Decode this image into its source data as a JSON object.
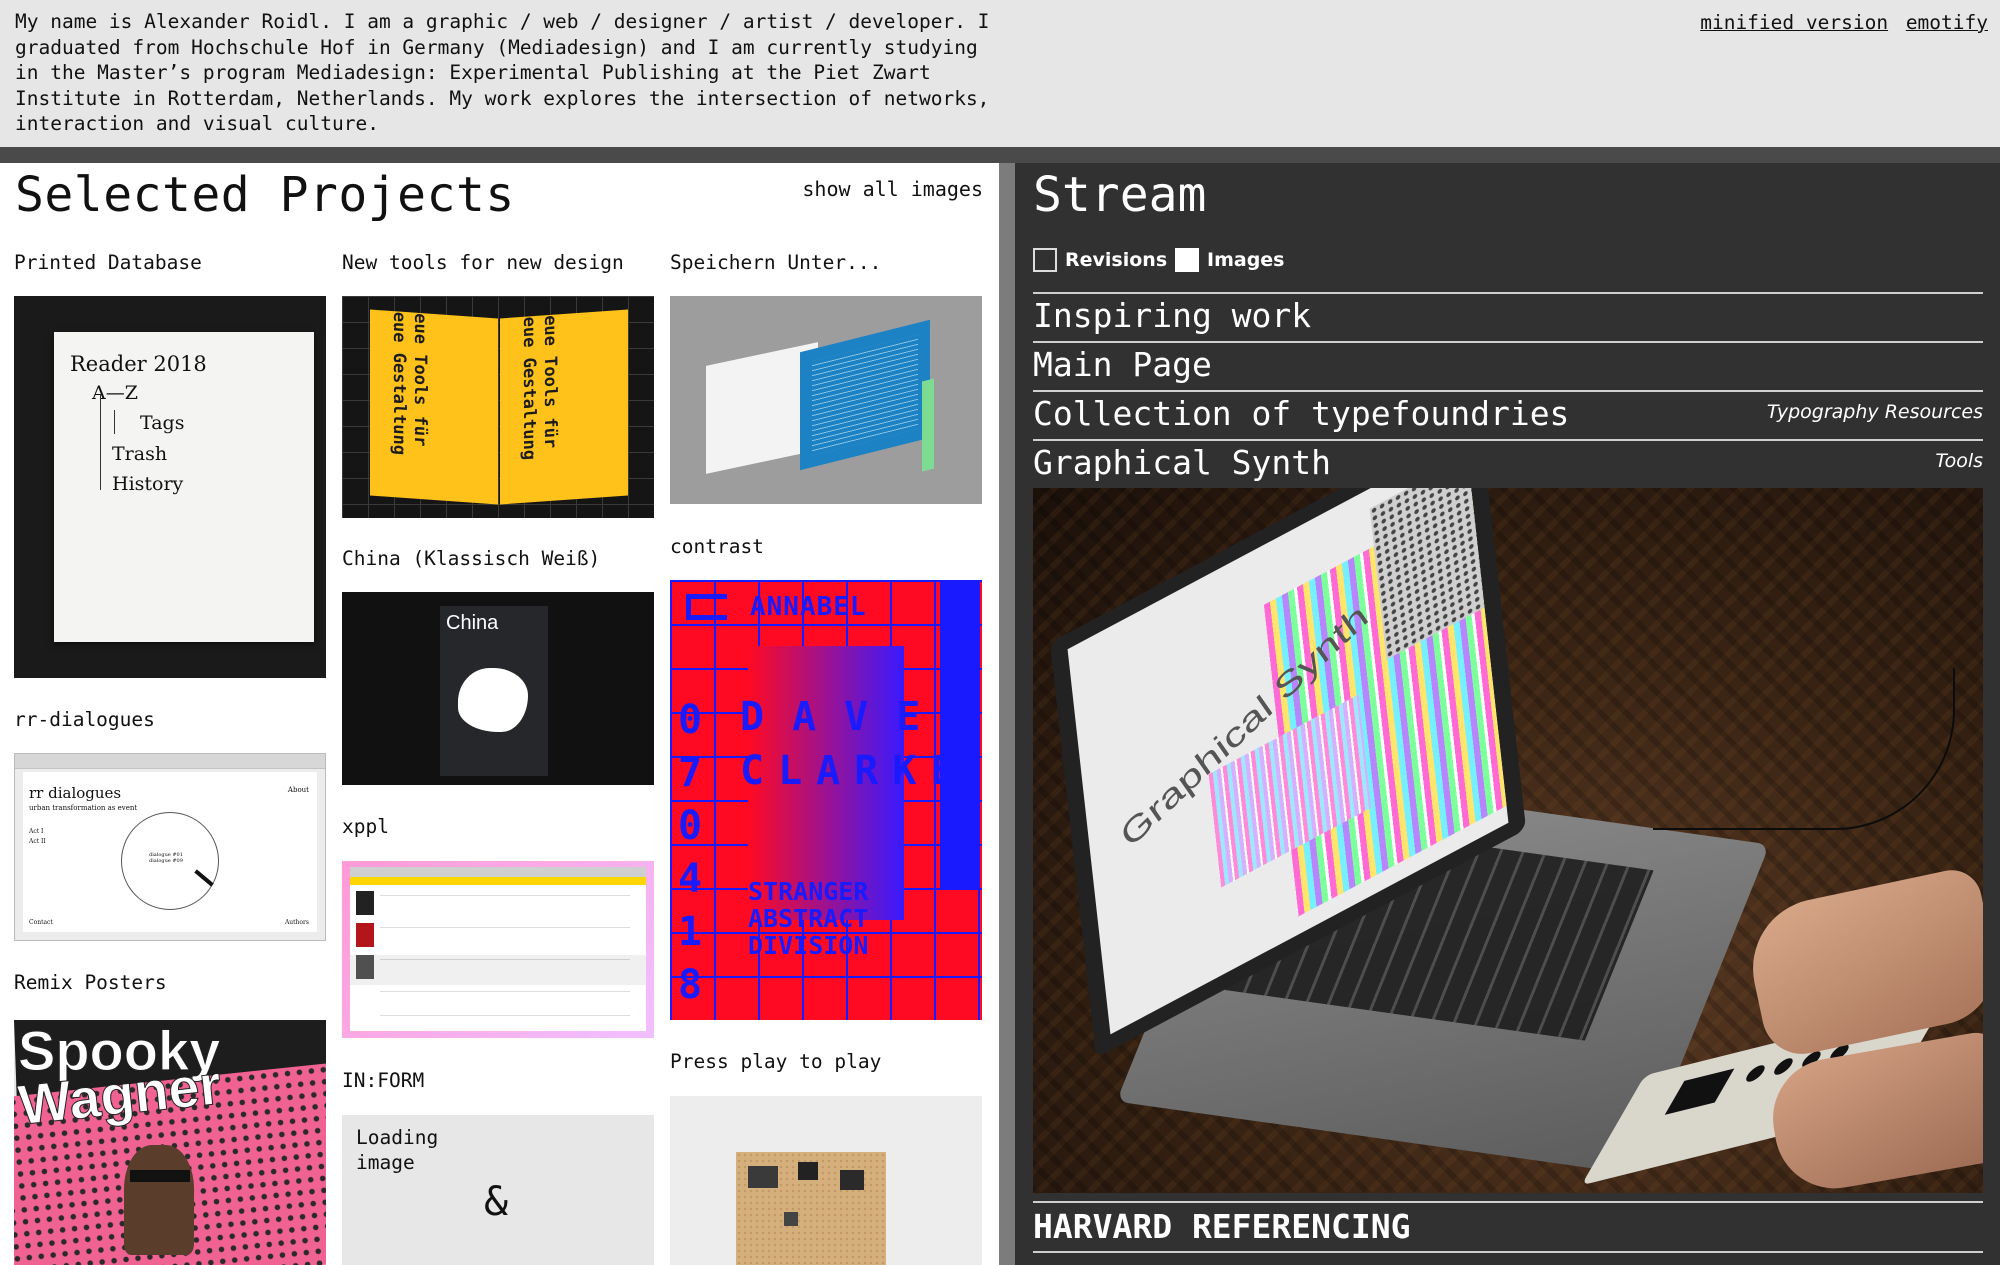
{
  "header": {
    "intro": "My name is Alexander Roidl. I am a graphic / web / designer / artist / developer. I graduated from Hochschule Hof in Germany (Mediadesign) and I am currently studying in the Master’s program Mediadesign: Experimental Publishing at the Piet Zwart Institute in Rotterdam, Netherlands. My work explores the intersection of networks, interaction and visual culture.",
    "links": [
      "minified version",
      "emotify"
    ]
  },
  "projects": {
    "title": "Selected Projects",
    "show_all": "show all images",
    "items": {
      "printed_database": "Printed Database",
      "rr_dialogues": "rr-dialogues",
      "remix_posters": "Remix Posters",
      "new_tools": "New tools for new design",
      "china": "China (Klassisch Weiß)",
      "xppl": "xppl",
      "inform": "IN:FORM",
      "speichern": "Speichern Unter...",
      "contrast": "contrast",
      "press_play": "Press play to play"
    },
    "thumb_text": {
      "reader_lines": [
        "Reader 2018",
        "A—Z",
        "Tags",
        "Trash",
        "History"
      ],
      "rr_title": "rr dialogues",
      "rr_subtitle": "urban transformation as event",
      "rr_about": "About",
      "rr_act1": "Act I",
      "rr_act2": "Act II",
      "rr_contact": "Contact",
      "rr_authors": "Authors",
      "rr_center": "dialogue #01\ndialogue #09",
      "china_label": "China",
      "poster_line1": "Spooky",
      "poster_line2": "Wagner",
      "loading": "Loading\nimage",
      "amp": "&",
      "annabel": "ANNABEL",
      "dave": "DAVE",
      "clarke": "CLARKE",
      "stranger1": "STRANGER",
      "stranger2": "ABSTRACT",
      "stranger3": "DIVISION",
      "digits": [
        "0",
        "7",
        "0",
        "4",
        "1",
        "8"
      ],
      "yellow_words": "Neue Tools für neue Gestaltung"
    }
  },
  "stream": {
    "title": "Stream",
    "checkbox_revisions": "Revisions",
    "checkbox_images": "Images",
    "items": [
      {
        "title": "Inspiring work",
        "tag": ""
      },
      {
        "title": "Main Page",
        "tag": ""
      },
      {
        "title": "Collection of typefoundries",
        "tag": "Typography Resources"
      },
      {
        "title": "Graphical Synth",
        "tag": "Tools"
      }
    ],
    "laptop_screen_text": "Graphical Synth",
    "harvard": "HARVARD REFERENCING"
  },
  "colors": {
    "header_bg": "#e6e6e6",
    "stream_bg": "#313131",
    "contrast_red": "#ff0a22",
    "contrast_blue": "#1a1aff",
    "yellow": "#ffc21a"
  }
}
